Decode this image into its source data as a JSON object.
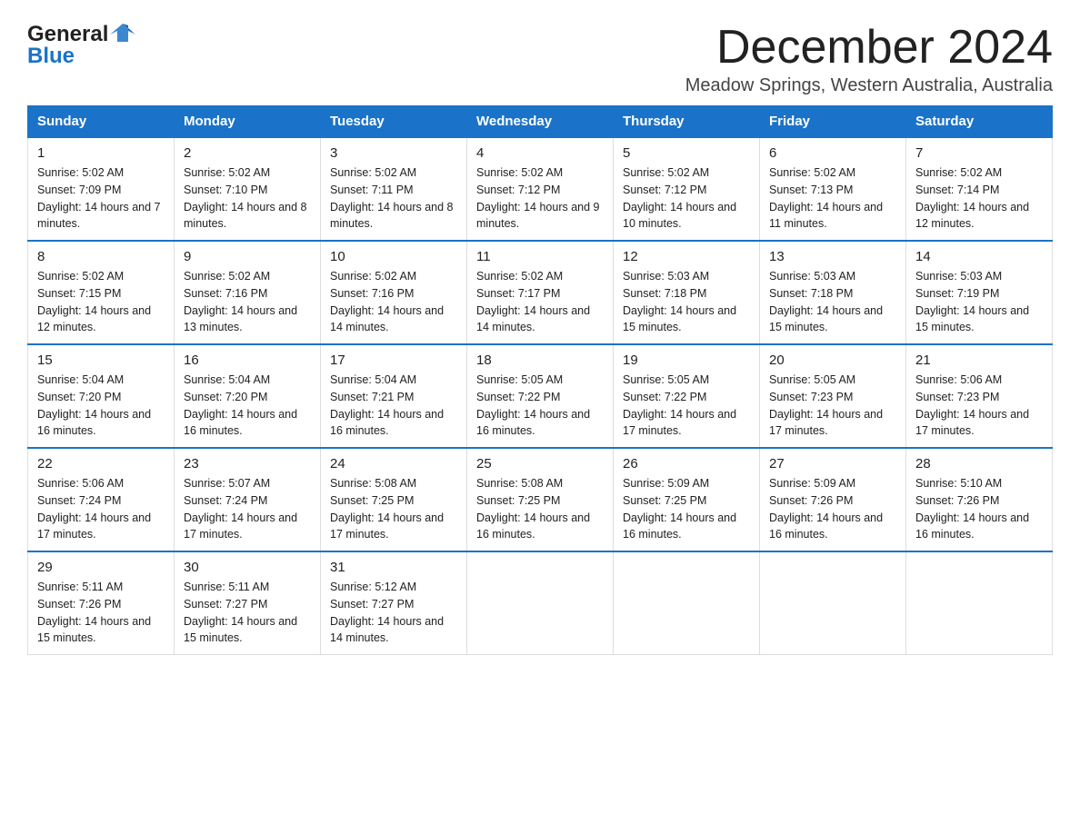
{
  "header": {
    "title": "December 2024",
    "subtitle": "Meadow Springs, Western Australia, Australia",
    "logo_general": "General",
    "logo_blue": "Blue"
  },
  "weekdays": [
    "Sunday",
    "Monday",
    "Tuesday",
    "Wednesday",
    "Thursday",
    "Friday",
    "Saturday"
  ],
  "weeks": [
    [
      {
        "day": "1",
        "sunrise": "Sunrise: 5:02 AM",
        "sunset": "Sunset: 7:09 PM",
        "daylight": "Daylight: 14 hours and 7 minutes."
      },
      {
        "day": "2",
        "sunrise": "Sunrise: 5:02 AM",
        "sunset": "Sunset: 7:10 PM",
        "daylight": "Daylight: 14 hours and 8 minutes."
      },
      {
        "day": "3",
        "sunrise": "Sunrise: 5:02 AM",
        "sunset": "Sunset: 7:11 PM",
        "daylight": "Daylight: 14 hours and 8 minutes."
      },
      {
        "day": "4",
        "sunrise": "Sunrise: 5:02 AM",
        "sunset": "Sunset: 7:12 PM",
        "daylight": "Daylight: 14 hours and 9 minutes."
      },
      {
        "day": "5",
        "sunrise": "Sunrise: 5:02 AM",
        "sunset": "Sunset: 7:12 PM",
        "daylight": "Daylight: 14 hours and 10 minutes."
      },
      {
        "day": "6",
        "sunrise": "Sunrise: 5:02 AM",
        "sunset": "Sunset: 7:13 PM",
        "daylight": "Daylight: 14 hours and 11 minutes."
      },
      {
        "day": "7",
        "sunrise": "Sunrise: 5:02 AM",
        "sunset": "Sunset: 7:14 PM",
        "daylight": "Daylight: 14 hours and 12 minutes."
      }
    ],
    [
      {
        "day": "8",
        "sunrise": "Sunrise: 5:02 AM",
        "sunset": "Sunset: 7:15 PM",
        "daylight": "Daylight: 14 hours and 12 minutes."
      },
      {
        "day": "9",
        "sunrise": "Sunrise: 5:02 AM",
        "sunset": "Sunset: 7:16 PM",
        "daylight": "Daylight: 14 hours and 13 minutes."
      },
      {
        "day": "10",
        "sunrise": "Sunrise: 5:02 AM",
        "sunset": "Sunset: 7:16 PM",
        "daylight": "Daylight: 14 hours and 14 minutes."
      },
      {
        "day": "11",
        "sunrise": "Sunrise: 5:02 AM",
        "sunset": "Sunset: 7:17 PM",
        "daylight": "Daylight: 14 hours and 14 minutes."
      },
      {
        "day": "12",
        "sunrise": "Sunrise: 5:03 AM",
        "sunset": "Sunset: 7:18 PM",
        "daylight": "Daylight: 14 hours and 15 minutes."
      },
      {
        "day": "13",
        "sunrise": "Sunrise: 5:03 AM",
        "sunset": "Sunset: 7:18 PM",
        "daylight": "Daylight: 14 hours and 15 minutes."
      },
      {
        "day": "14",
        "sunrise": "Sunrise: 5:03 AM",
        "sunset": "Sunset: 7:19 PM",
        "daylight": "Daylight: 14 hours and 15 minutes."
      }
    ],
    [
      {
        "day": "15",
        "sunrise": "Sunrise: 5:04 AM",
        "sunset": "Sunset: 7:20 PM",
        "daylight": "Daylight: 14 hours and 16 minutes."
      },
      {
        "day": "16",
        "sunrise": "Sunrise: 5:04 AM",
        "sunset": "Sunset: 7:20 PM",
        "daylight": "Daylight: 14 hours and 16 minutes."
      },
      {
        "day": "17",
        "sunrise": "Sunrise: 5:04 AM",
        "sunset": "Sunset: 7:21 PM",
        "daylight": "Daylight: 14 hours and 16 minutes."
      },
      {
        "day": "18",
        "sunrise": "Sunrise: 5:05 AM",
        "sunset": "Sunset: 7:22 PM",
        "daylight": "Daylight: 14 hours and 16 minutes."
      },
      {
        "day": "19",
        "sunrise": "Sunrise: 5:05 AM",
        "sunset": "Sunset: 7:22 PM",
        "daylight": "Daylight: 14 hours and 17 minutes."
      },
      {
        "day": "20",
        "sunrise": "Sunrise: 5:05 AM",
        "sunset": "Sunset: 7:23 PM",
        "daylight": "Daylight: 14 hours and 17 minutes."
      },
      {
        "day": "21",
        "sunrise": "Sunrise: 5:06 AM",
        "sunset": "Sunset: 7:23 PM",
        "daylight": "Daylight: 14 hours and 17 minutes."
      }
    ],
    [
      {
        "day": "22",
        "sunrise": "Sunrise: 5:06 AM",
        "sunset": "Sunset: 7:24 PM",
        "daylight": "Daylight: 14 hours and 17 minutes."
      },
      {
        "day": "23",
        "sunrise": "Sunrise: 5:07 AM",
        "sunset": "Sunset: 7:24 PM",
        "daylight": "Daylight: 14 hours and 17 minutes."
      },
      {
        "day": "24",
        "sunrise": "Sunrise: 5:08 AM",
        "sunset": "Sunset: 7:25 PM",
        "daylight": "Daylight: 14 hours and 17 minutes."
      },
      {
        "day": "25",
        "sunrise": "Sunrise: 5:08 AM",
        "sunset": "Sunset: 7:25 PM",
        "daylight": "Daylight: 14 hours and 16 minutes."
      },
      {
        "day": "26",
        "sunrise": "Sunrise: 5:09 AM",
        "sunset": "Sunset: 7:25 PM",
        "daylight": "Daylight: 14 hours and 16 minutes."
      },
      {
        "day": "27",
        "sunrise": "Sunrise: 5:09 AM",
        "sunset": "Sunset: 7:26 PM",
        "daylight": "Daylight: 14 hours and 16 minutes."
      },
      {
        "day": "28",
        "sunrise": "Sunrise: 5:10 AM",
        "sunset": "Sunset: 7:26 PM",
        "daylight": "Daylight: 14 hours and 16 minutes."
      }
    ],
    [
      {
        "day": "29",
        "sunrise": "Sunrise: 5:11 AM",
        "sunset": "Sunset: 7:26 PM",
        "daylight": "Daylight: 14 hours and 15 minutes."
      },
      {
        "day": "30",
        "sunrise": "Sunrise: 5:11 AM",
        "sunset": "Sunset: 7:27 PM",
        "daylight": "Daylight: 14 hours and 15 minutes."
      },
      {
        "day": "31",
        "sunrise": "Sunrise: 5:12 AM",
        "sunset": "Sunset: 7:27 PM",
        "daylight": "Daylight: 14 hours and 14 minutes."
      },
      null,
      null,
      null,
      null
    ]
  ]
}
